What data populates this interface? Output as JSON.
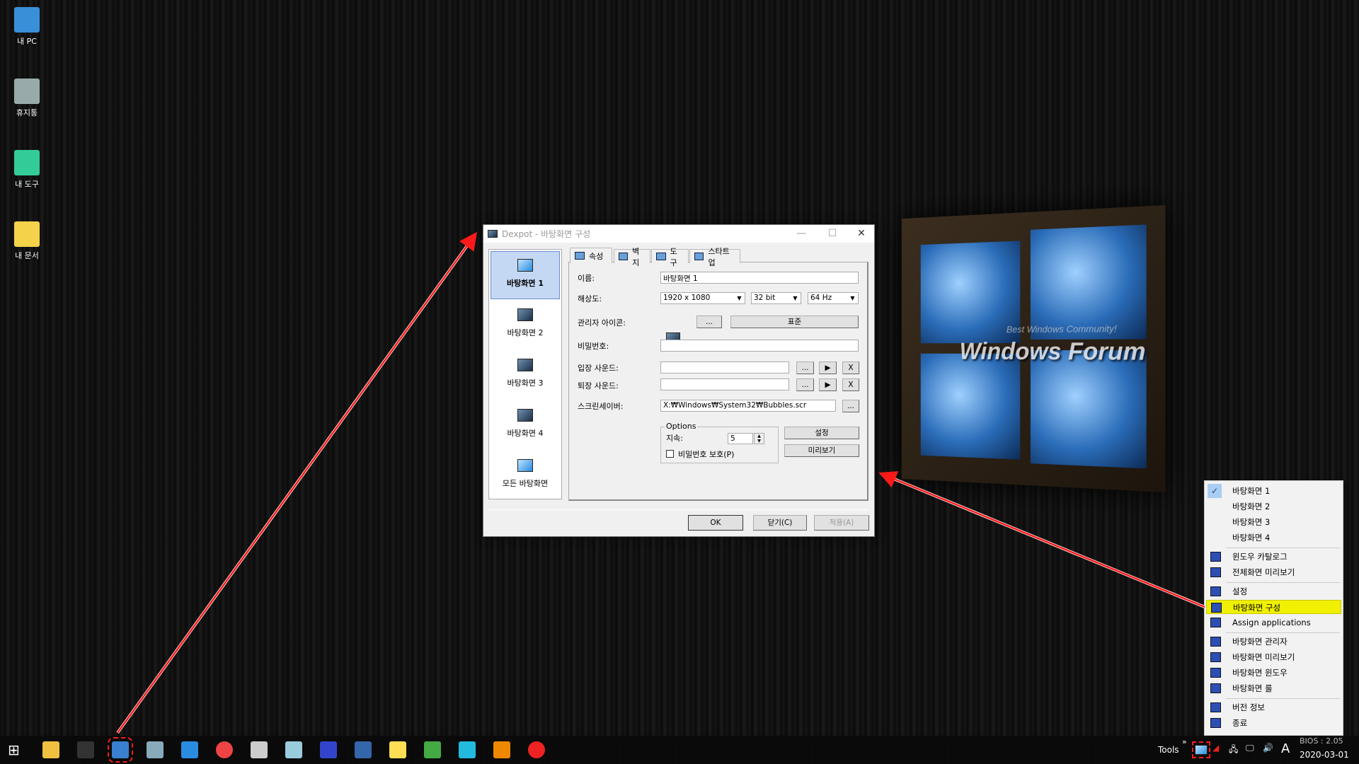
{
  "desktop_icons": [
    {
      "label": "내 PC",
      "icon": "computer-icon"
    },
    {
      "label": "휴지통",
      "icon": "recycle-bin-icon"
    },
    {
      "label": "내 도구",
      "icon": "tools-folder-icon"
    },
    {
      "label": "내 문서",
      "icon": "documents-folder-icon"
    }
  ],
  "wallpaper": {
    "brand": "Windows Forum",
    "tagline": "Best Windows Community!"
  },
  "dialog": {
    "title": "Dexpot - 바탕화면 구성",
    "desktops": [
      "바탕화면 1",
      "바탕화면 2",
      "바탕화면 3",
      "바탕화면 4",
      "모든 바탕화면"
    ],
    "tabs": [
      "속성",
      "벽지",
      "도구",
      "스타트업"
    ],
    "labels": {
      "name": "이름:",
      "resolution": "해상도:",
      "admin_icon": "관리자 아이콘:",
      "password": "비밀번호:",
      "enter_sound": "입장 사운드:",
      "exit_sound": "퇴장 사운드:",
      "screensaver": "스크린세이버:"
    },
    "name_value": "바탕화면 1",
    "resolution": "1920 x 1080",
    "color_depth": "32 bit",
    "refresh": "64 Hz",
    "browse": "...",
    "standard": "표준",
    "play": "▶",
    "clear": "X",
    "password_value": "",
    "enter_sound_value": "",
    "exit_sound_value": "",
    "screensaver_value": "X:₩Windows₩System32₩Bubbles.scr",
    "options": {
      "legend": "Options",
      "duration_label": "지속:",
      "duration_value": "5",
      "password_protect": "비밀번호 보호(P)",
      "password_protect_checked": false
    },
    "settings_btn": "설정",
    "preview_btn": "미리보기",
    "ok": "OK",
    "close": "닫기(C)",
    "apply": "적용(A)"
  },
  "menu": {
    "items": [
      {
        "label": "바탕화면 1",
        "checked": true
      },
      {
        "label": "바탕화면 2"
      },
      {
        "label": "바탕화면 3"
      },
      {
        "label": "바탕화면 4"
      },
      {
        "sep": true
      },
      {
        "label": "윈도우 카탈로그",
        "icon": "catalog-icon"
      },
      {
        "label": "전체화면 미리보기",
        "icon": "fullscreen-preview-icon"
      },
      {
        "sep": true
      },
      {
        "label": "설정",
        "icon": "settings-icon"
      },
      {
        "label": "바탕화면 구성",
        "icon": "desktop-config-icon",
        "highlight": true
      },
      {
        "label": "Assign applications",
        "icon": "assign-icon"
      },
      {
        "sep": true
      },
      {
        "label": "바탕화면 관리자",
        "icon": "manager-icon"
      },
      {
        "label": "바탕화면 미리보기",
        "icon": "preview-icon"
      },
      {
        "label": "바탕화면 윈도우",
        "icon": "windows-icon"
      },
      {
        "label": "바탕화면 룰",
        "icon": "rules-icon"
      },
      {
        "sep": true
      },
      {
        "label": "버전 정보",
        "icon": "info-bulb-icon"
      },
      {
        "label": "종료",
        "icon": "exit-icon"
      }
    ]
  },
  "taskbar": {
    "apps": [
      "start",
      "file-explorer",
      "terminal",
      "dexpot",
      "monitor",
      "internet-explorer",
      "chrome",
      "scanner",
      "notepad",
      "pixel-tool",
      "save",
      "new-file",
      "tools",
      "network-app",
      "package",
      "power"
    ],
    "tools_label": "Tools",
    "chevron": "»",
    "ime": "A",
    "clock_top": "BIOS : 2.05",
    "date": "2020-03-01"
  },
  "colors": {
    "highlight": "#f0f000",
    "arrow": "#ff1a1a",
    "selection": "#c5d8f3"
  }
}
